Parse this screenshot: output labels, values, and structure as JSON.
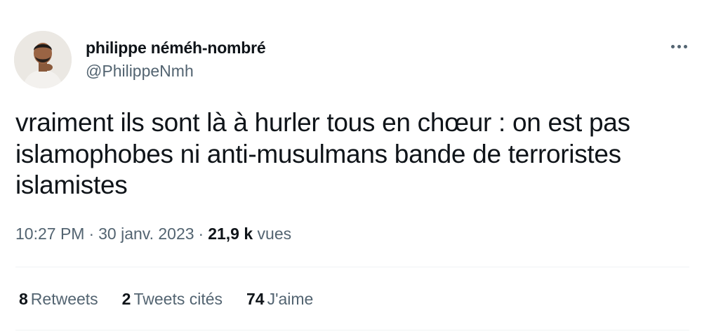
{
  "author": {
    "display_name": "philippe néméh-nombré",
    "handle": "@PhilippeNmh",
    "avatar_icon": "profile-photo"
  },
  "tweet": {
    "text": "vraiment ils sont là à hurler tous en chœur : on est pas islamophobes ni anti-musulmans bande de terroristes islamistes",
    "time": "10:27 PM",
    "separator": "·",
    "date": "30 janv. 2023",
    "views_count": "21,9 k",
    "views_label": "vues"
  },
  "stats": {
    "retweets_count": "8",
    "retweets_label": "Retweets",
    "quotes_count": "2",
    "quotes_label": "Tweets cités",
    "likes_count": "74",
    "likes_label": "J'aime"
  },
  "menu": {
    "icon": "more-horizontal-icon"
  },
  "colors": {
    "text_primary": "#0f1419",
    "text_secondary": "#536471",
    "divider": "#eff3f4"
  }
}
